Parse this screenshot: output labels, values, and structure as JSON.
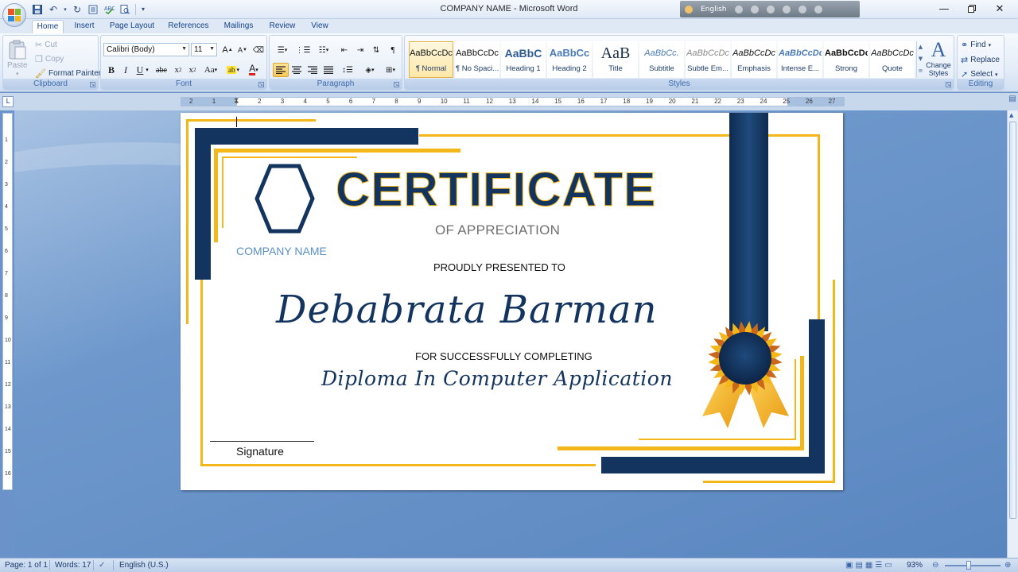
{
  "window": {
    "title": "COMPANY NAME - Microsoft Word",
    "language_bar": "English"
  },
  "tabs": [
    "Home",
    "Insert",
    "Page Layout",
    "References",
    "Mailings",
    "Review",
    "View"
  ],
  "ribbon": {
    "clipboard": {
      "label": "Clipboard",
      "paste": "Paste",
      "cut": "Cut",
      "copy": "Copy",
      "format_painter": "Format Painter"
    },
    "font": {
      "label": "Font",
      "font_name": "Calibri (Body)",
      "font_size": "11"
    },
    "paragraph": {
      "label": "Paragraph"
    },
    "styles": {
      "label": "Styles",
      "items": [
        {
          "preview": "AaBbCcDc",
          "name": "¶ Normal"
        },
        {
          "preview": "AaBbCcDc",
          "name": "¶ No Spaci..."
        },
        {
          "preview": "AaBbC",
          "name": "Heading 1"
        },
        {
          "preview": "AaBbCc",
          "name": "Heading 2"
        },
        {
          "preview": "AaB",
          "name": "Title"
        },
        {
          "preview": "AaBbCc.",
          "name": "Subtitle"
        },
        {
          "preview": "AaBbCcDc",
          "name": "Subtle Em..."
        },
        {
          "preview": "AaBbCcDc",
          "name": "Emphasis"
        },
        {
          "preview": "AaBbCcDc",
          "name": "Intense E..."
        },
        {
          "preview": "AaBbCcDc",
          "name": "Strong"
        },
        {
          "preview": "AaBbCcDc",
          "name": "Quote"
        }
      ],
      "change_styles": "Change Styles"
    },
    "editing": {
      "label": "Editing",
      "find": "Find",
      "replace": "Replace",
      "select": "Select"
    }
  },
  "ruler": {
    "h_numbers": [
      "2",
      "1",
      "1",
      "2",
      "3",
      "4",
      "5",
      "6",
      "7",
      "8",
      "9",
      "10",
      "11",
      "12",
      "13",
      "14",
      "15",
      "16",
      "17",
      "18",
      "19",
      "20",
      "21",
      "22",
      "23",
      "24",
      "25",
      "26",
      "27"
    ],
    "v_numbers": [
      "1",
      "2",
      "3",
      "4",
      "5",
      "6",
      "7",
      "8",
      "9",
      "10",
      "11",
      "12",
      "13",
      "14",
      "15",
      "16"
    ]
  },
  "certificate": {
    "title": "CERTIFICATE",
    "subtitle": "OF APPRECIATION",
    "company": "COMPANY NAME",
    "presented": "PROUDLY PRESENTED TO",
    "recipient": "Debabrata Barman",
    "for_text": "FOR SUCCESSFULLY COMPLETING",
    "course": "Diploma In Computer Application",
    "signature": "Signature",
    "colors": {
      "navy": "#13345e",
      "gold": "#f4b719",
      "company_blue": "#5a8fc6"
    }
  },
  "status": {
    "page": "Page: 1 of 1",
    "words": "Words: 17",
    "language": "English (U.S.)",
    "zoom": "93%"
  }
}
